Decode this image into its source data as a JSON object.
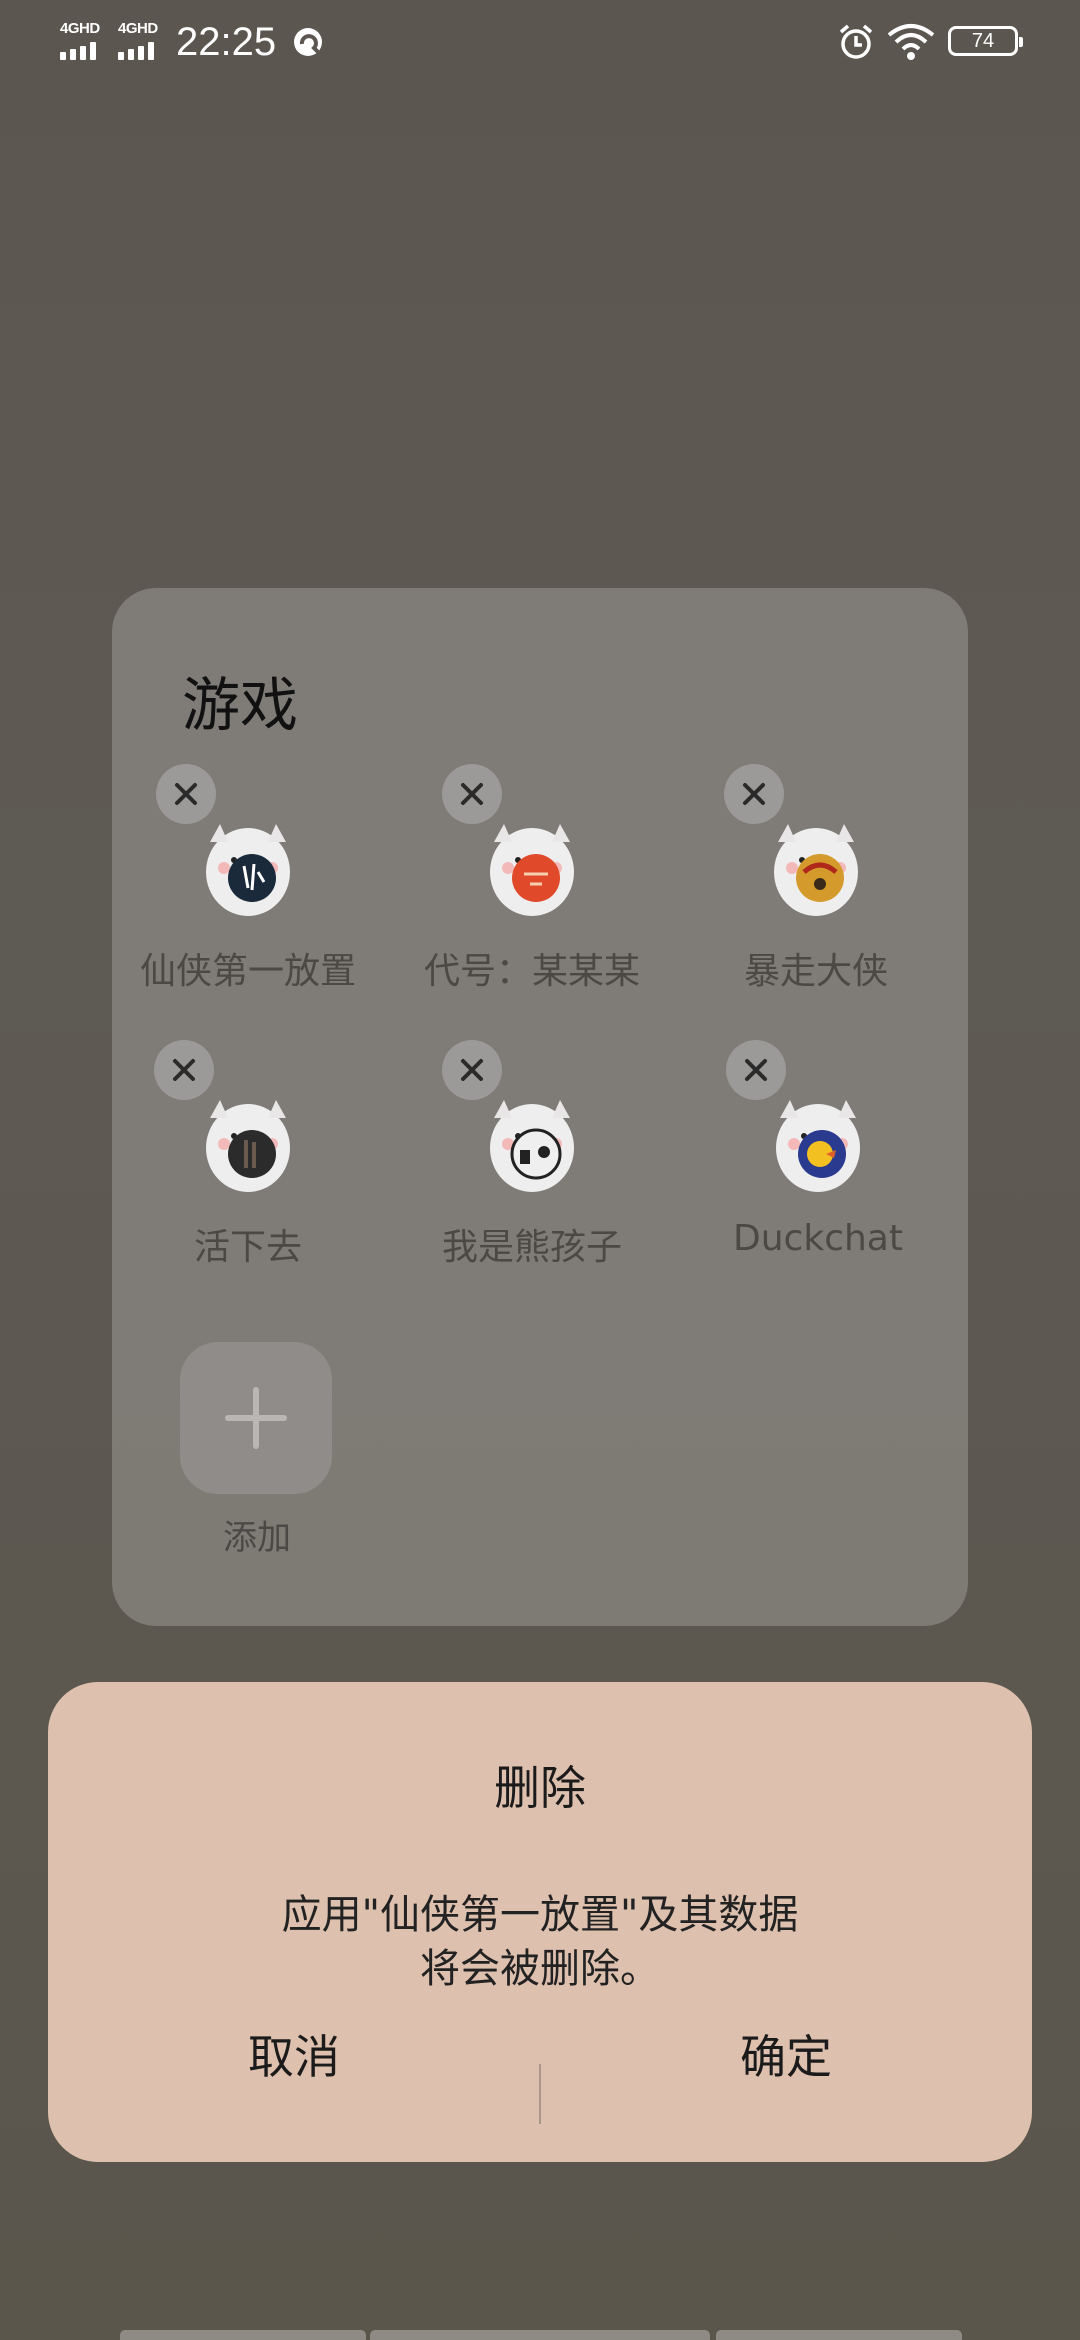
{
  "status_bar": {
    "signal_1": "4GHD",
    "signal_2": "4GHD",
    "time": "22:25",
    "battery": "74",
    "icons": [
      "q-app-icon",
      "alarm-icon",
      "wifi-icon",
      "battery-icon"
    ]
  },
  "folder": {
    "title": "游戏",
    "apps": [
      {
        "label": "仙侠第一放置",
        "icon": "game-icon-xianxia",
        "accent": "#1b2a3a"
      },
      {
        "label": "代号：某某某",
        "icon": "game-icon-daihao",
        "accent": "#e04a2a"
      },
      {
        "label": "暴走大侠",
        "icon": "game-icon-baozou",
        "accent": "#d49a2c"
      },
      {
        "label": "活下去",
        "icon": "game-icon-huoxiaqu",
        "accent": "#2b2b2b"
      },
      {
        "label": "我是熊孩子",
        "icon": "game-icon-xionghaizi",
        "accent": "#efefef"
      },
      {
        "label": "Duckchat",
        "icon": "game-icon-duckchat",
        "accent": "#2a3a8e"
      }
    ],
    "add_label": "添加"
  },
  "dialog": {
    "title": "删除",
    "message_line1": "应用\"仙侠第一放置\"及其数据",
    "message_line2": "将会被删除。",
    "cancel_label": "取消",
    "confirm_label": "确定"
  },
  "colors": {
    "dialog_bg": "#dec0ae",
    "panel_bg": "#86827e",
    "wallpaper": "#5c5650"
  }
}
